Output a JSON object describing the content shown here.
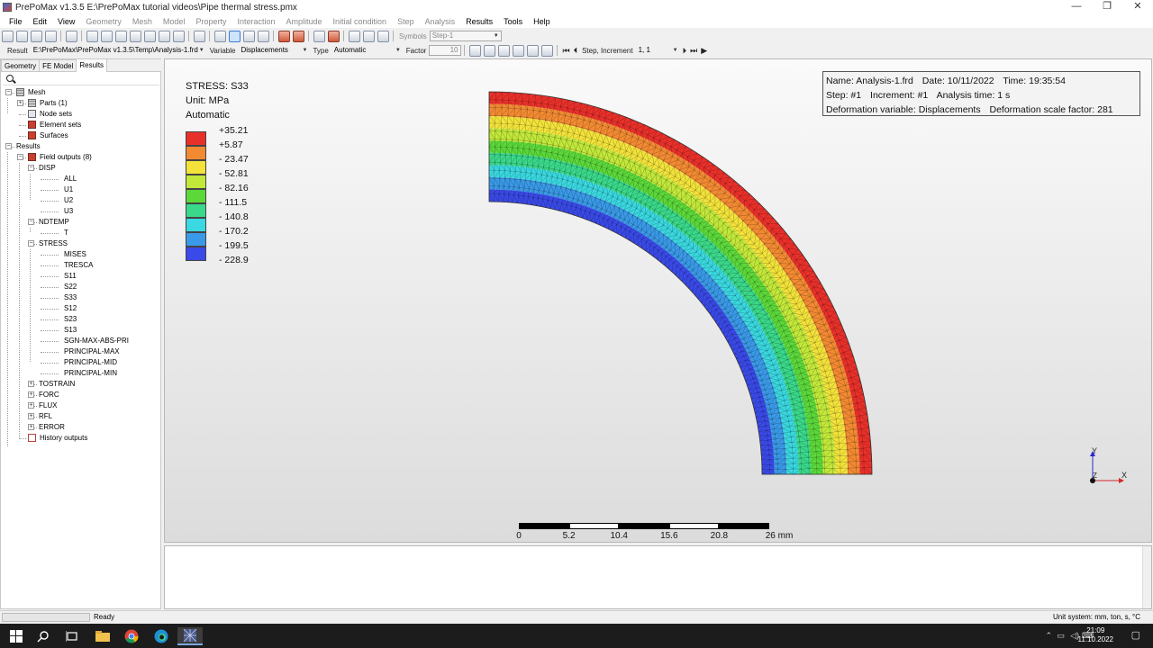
{
  "window": {
    "title": "PrePoMax v1.3.5  E:\\PrePoMax tutorial videos\\Pipe thermal stress.pmx",
    "minimize_glyph": "—",
    "restore_glyph": "❐",
    "close_glyph": "✕"
  },
  "menu": [
    {
      "label": "File",
      "enabled": true
    },
    {
      "label": "Edit",
      "enabled": true
    },
    {
      "label": "View",
      "enabled": true
    },
    {
      "label": "Geometry",
      "enabled": false
    },
    {
      "label": "Mesh",
      "enabled": false
    },
    {
      "label": "Model",
      "enabled": false
    },
    {
      "label": "Property",
      "enabled": false
    },
    {
      "label": "Interaction",
      "enabled": false
    },
    {
      "label": "Amplitude",
      "enabled": false
    },
    {
      "label": "Initial condition",
      "enabled": false
    },
    {
      "label": "Step",
      "enabled": false
    },
    {
      "label": "Analysis",
      "enabled": false
    },
    {
      "label": "Results",
      "enabled": true
    },
    {
      "label": "Tools",
      "enabled": true
    },
    {
      "label": "Help",
      "enabled": true
    }
  ],
  "toolbar1": {
    "symbols_label": "Symbols",
    "symbols_value": "Step-1"
  },
  "toolbar2": {
    "result_label": "Result",
    "result_value": "E:\\PrePoMax\\PrePoMax v1.3.5\\Temp\\Analysis-1.frd",
    "variable_label": "Variable",
    "variable_value": "Displacements",
    "type_label": "Type",
    "type_value": "Automatic",
    "factor_label": "Factor",
    "factor_value": "10",
    "step_increment_label": "Step, Increment",
    "step_increment_value": "1, 1"
  },
  "tabs": [
    {
      "label": "Geometry",
      "active": false
    },
    {
      "label": "FE Model",
      "active": false
    },
    {
      "label": "Results",
      "active": true
    }
  ],
  "tree": [
    {
      "label": "Mesh",
      "level": 0,
      "icon": "mesh-icon",
      "expander": "minus"
    },
    {
      "label": "Parts (1)",
      "level": 1,
      "icon": "parts-icon",
      "expander": "plus"
    },
    {
      "label": "Node sets",
      "level": 1,
      "icon": "node-sets-icon",
      "expander": ""
    },
    {
      "label": "Element sets",
      "level": 1,
      "icon": "element-sets-icon",
      "expander": ""
    },
    {
      "label": "Surfaces",
      "level": 1,
      "icon": "surfaces-icon",
      "expander": ""
    },
    {
      "label": "Results",
      "level": 0,
      "icon": "",
      "expander": "minus"
    },
    {
      "label": "Field outputs (8)",
      "level": 1,
      "icon": "field-outputs-icon",
      "expander": "minus"
    },
    {
      "label": "DISP",
      "level": 2,
      "icon": "",
      "expander": "minus"
    },
    {
      "label": "ALL",
      "level": 3,
      "icon": "",
      "expander": ""
    },
    {
      "label": "U1",
      "level": 3,
      "icon": "",
      "expander": ""
    },
    {
      "label": "U2",
      "level": 3,
      "icon": "",
      "expander": ""
    },
    {
      "label": "U3",
      "level": 3,
      "icon": "",
      "expander": ""
    },
    {
      "label": "NDTEMP",
      "level": 2,
      "icon": "",
      "expander": "minus"
    },
    {
      "label": "T",
      "level": 3,
      "icon": "",
      "expander": ""
    },
    {
      "label": "STRESS",
      "level": 2,
      "icon": "",
      "expander": "minus"
    },
    {
      "label": "MISES",
      "level": 3,
      "icon": "",
      "expander": ""
    },
    {
      "label": "TRESCA",
      "level": 3,
      "icon": "",
      "expander": ""
    },
    {
      "label": "S11",
      "level": 3,
      "icon": "",
      "expander": ""
    },
    {
      "label": "S22",
      "level": 3,
      "icon": "",
      "expander": ""
    },
    {
      "label": "S33",
      "level": 3,
      "icon": "",
      "expander": ""
    },
    {
      "label": "S12",
      "level": 3,
      "icon": "",
      "expander": ""
    },
    {
      "label": "S23",
      "level": 3,
      "icon": "",
      "expander": ""
    },
    {
      "label": "S13",
      "level": 3,
      "icon": "",
      "expander": ""
    },
    {
      "label": "SGN-MAX-ABS-PRI",
      "level": 3,
      "icon": "",
      "expander": ""
    },
    {
      "label": "PRINCIPAL-MAX",
      "level": 3,
      "icon": "",
      "expander": ""
    },
    {
      "label": "PRINCIPAL-MID",
      "level": 3,
      "icon": "",
      "expander": ""
    },
    {
      "label": "PRINCIPAL-MIN",
      "level": 3,
      "icon": "",
      "expander": ""
    },
    {
      "label": "TOSTRAIN",
      "level": 2,
      "icon": "",
      "expander": "plus"
    },
    {
      "label": "FORC",
      "level": 2,
      "icon": "",
      "expander": "plus"
    },
    {
      "label": "FLUX",
      "level": 2,
      "icon": "",
      "expander": "plus"
    },
    {
      "label": "RFL",
      "level": 2,
      "icon": "",
      "expander": "plus"
    },
    {
      "label": "ERROR",
      "level": 2,
      "icon": "",
      "expander": "plus"
    },
    {
      "label": "History outputs",
      "level": 1,
      "icon": "history-outputs-icon",
      "expander": ""
    }
  ],
  "legend": {
    "title": "STRESS: S33",
    "unit": "Unit: MPa",
    "mode": "Automatic",
    "values": [
      "+35.21",
      "+5.87",
      "- 23.47",
      "- 52.81",
      "- 82.16",
      "- 111.5",
      "- 140.8",
      "- 170.2",
      "- 199.5",
      "- 228.9"
    ],
    "colors": [
      "#e8302a",
      "#f28a32",
      "#f2e23a",
      "#c2e83a",
      "#5cd83a",
      "#3ad88a",
      "#3ad8e0",
      "#3a9ae8",
      "#3a4ae8"
    ]
  },
  "info": {
    "name": "Name: Analysis-1.frd",
    "date": "Date: 10/11/2022",
    "time": "Time: 19:35:54",
    "step": "Step: #1",
    "increment": "Increment: #1",
    "analysis_time": "Analysis time: 1 s",
    "deformation_variable": "Deformation variable: Displacements",
    "deformation_scale": "Deformation scale factor: 281"
  },
  "scale_bar": {
    "ticks": [
      "0",
      "5.2",
      "10.4",
      "15.6",
      "20.8",
      "26 mm"
    ]
  },
  "triad": {
    "y": "Y",
    "z": "Z",
    "x": "X"
  },
  "status": {
    "text": "Ready",
    "unit_system": "Unit system: mm, ton, s, °C"
  },
  "taskbar": {
    "time": "21:09",
    "date": "11.10.2022"
  }
}
